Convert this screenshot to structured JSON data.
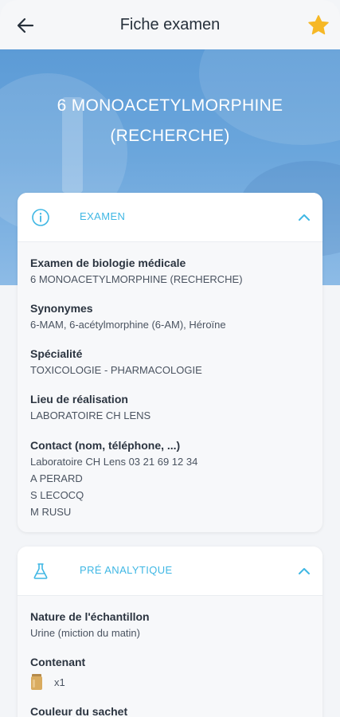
{
  "header": {
    "title": "Fiche examen"
  },
  "hero": {
    "title_line1": "6 MONOACETYLMORPHINE",
    "title_line2": "(RECHERCHE)"
  },
  "colors": {
    "accent": "#3fb7e4",
    "star": "#f6b826",
    "hero": "#6ba6dc"
  },
  "sections": {
    "examen": {
      "title": "EXAMEN",
      "icon": "info-icon",
      "fields": {
        "biologie": {
          "label": "Examen de biologie médicale",
          "value": "6 MONOACETYLMORPHINE (RECHERCHE)"
        },
        "synonymes": {
          "label": "Synonymes",
          "value": "6-MAM, 6-acétylmorphine (6-AM), Héroïne"
        },
        "specialite": {
          "label": "Spécialité",
          "value": "TOXICOLOGIE - PHARMACOLOGIE"
        },
        "lieu": {
          "label": "Lieu de réalisation",
          "value": "LABORATOIRE CH LENS"
        },
        "contact": {
          "label": "Contact (nom, téléphone, ...)",
          "lines": [
            "Laboratoire CH Lens 03 21 69 12 34",
            "A PERARD",
            "S LECOCQ",
            "M RUSU"
          ]
        }
      }
    },
    "pre_analytique": {
      "title": "PRÉ ANALYTIQUE",
      "icon": "flask-icon",
      "fields": {
        "nature": {
          "label": "Nature de l'échantillon",
          "value": "Urine (miction du matin)"
        },
        "contenant": {
          "label": "Contenant",
          "value": "x1",
          "icon": "container-icon"
        },
        "couleur": {
          "label": "Couleur du sachet"
        }
      }
    }
  }
}
